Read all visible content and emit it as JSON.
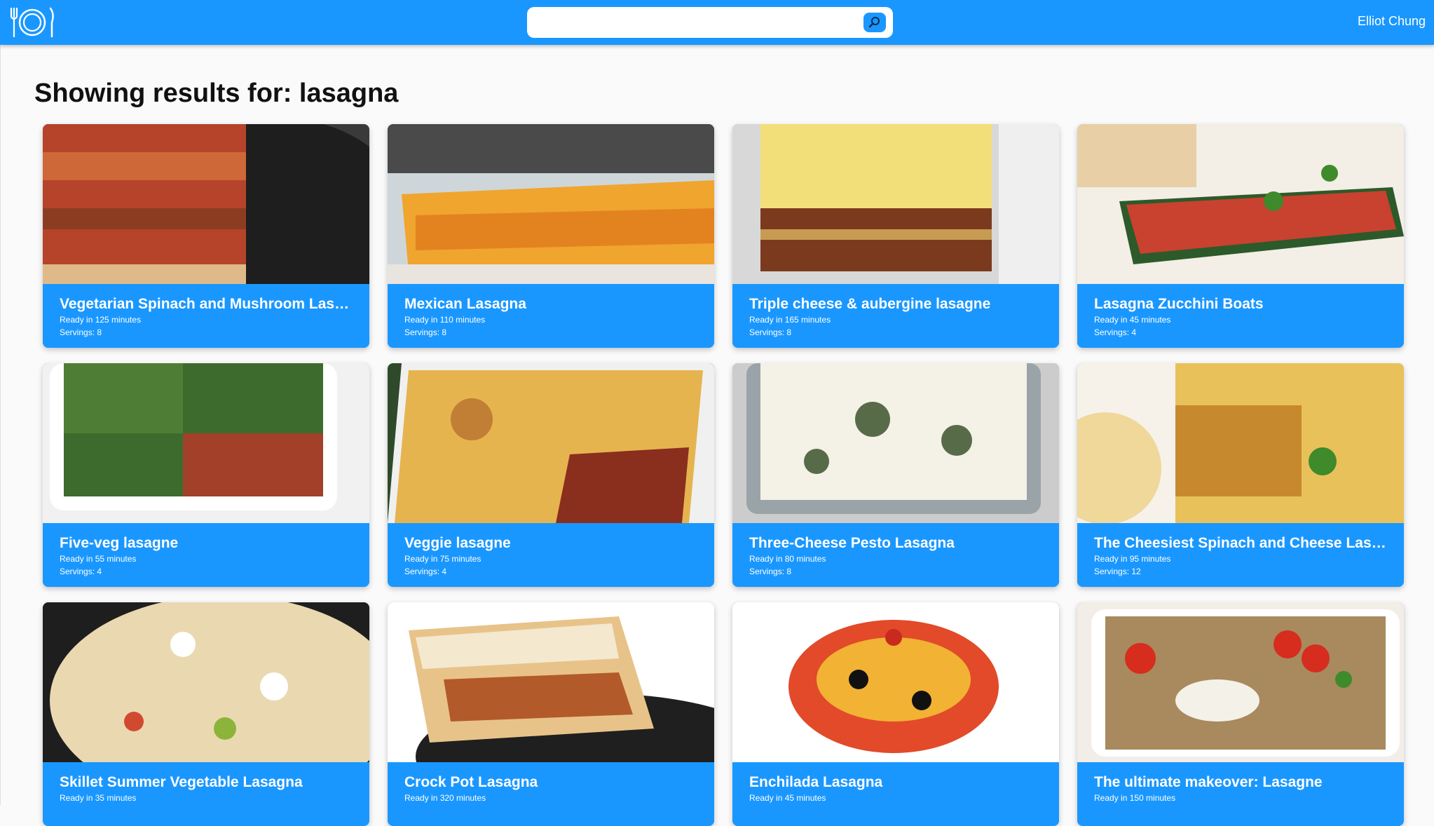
{
  "header": {
    "search": {
      "value": "",
      "placeholder": ""
    },
    "user_name": "Elliot Chung"
  },
  "page": {
    "heading": "Showing results for: lasagna"
  },
  "recipes": [
    {
      "title": "Vegetarian Spinach and Mushroom Lasagna",
      "ready": "Ready in 125 minutes",
      "servings": "Servings: 8"
    },
    {
      "title": "Mexican Lasagna",
      "ready": "Ready in 110 minutes",
      "servings": "Servings: 8"
    },
    {
      "title": "Triple cheese & aubergine lasagne",
      "ready": "Ready in 165 minutes",
      "servings": "Servings: 8"
    },
    {
      "title": "Lasagna Zucchini Boats",
      "ready": "Ready in 45 minutes",
      "servings": "Servings: 4"
    },
    {
      "title": "Five-veg lasagne",
      "ready": "Ready in 55 minutes",
      "servings": "Servings: 4"
    },
    {
      "title": "Veggie lasagne",
      "ready": "Ready in 75 minutes",
      "servings": "Servings: 4"
    },
    {
      "title": "Three-Cheese Pesto Lasagna",
      "ready": "Ready in 80 minutes",
      "servings": "Servings: 8"
    },
    {
      "title": "The Cheesiest Spinach and Cheese Lasagna",
      "ready": "Ready in 95 minutes",
      "servings": "Servings: 12"
    },
    {
      "title": "Skillet Summer Vegetable Lasagna",
      "ready": "Ready in 35 minutes",
      "servings": ""
    },
    {
      "title": "Crock Pot Lasagna",
      "ready": "Ready in 320 minutes",
      "servings": ""
    },
    {
      "title": "Enchilada Lasagna",
      "ready": "Ready in 45 minutes",
      "servings": ""
    },
    {
      "title": "The ultimate makeover: Lasagne",
      "ready": "Ready in 150 minutes",
      "servings": ""
    }
  ],
  "colors": {
    "brand": "#1a97ff",
    "background": "#fafafa"
  },
  "icons": {
    "logo": "plate-fork-knife-icon",
    "search": "search-icon"
  }
}
